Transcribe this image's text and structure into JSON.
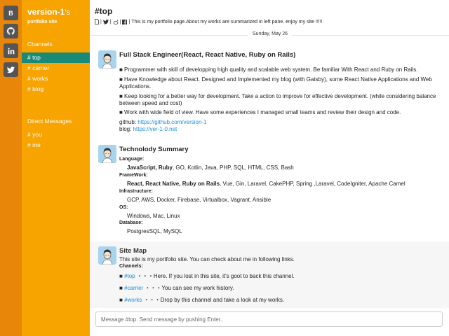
{
  "appbar": {
    "items": [
      {
        "label": "B",
        "icon": "blog-icon"
      },
      {
        "label": "",
        "icon": "github-icon"
      },
      {
        "label": "",
        "icon": "linkedin-icon"
      },
      {
        "label": "",
        "icon": "twitter-icon"
      }
    ]
  },
  "sidebar": {
    "workspace_name": "version-1",
    "workspace_suffix": "'s",
    "workspace_sub": "portfolio site",
    "channels_title": "Channels",
    "channels": [
      "# top",
      "# carrier",
      "# works",
      "# blog"
    ],
    "active_channel": "# top",
    "dm_title": "Direct Messages",
    "dms": [
      "# you",
      "# me"
    ]
  },
  "header": {
    "title": "#top",
    "topic_seps": [
      "|",
      "|",
      "|",
      "|"
    ],
    "topic": "This is my portfolio page.About my works are summarized in left pane. enjoy my site !!!!!"
  },
  "date_divider": "Sunday, May 26",
  "messages": {
    "m1": {
      "title": "Full Stack Engineer(React, React Native, Ruby on Rails)",
      "p1": "■ Programmer with skill of developping high quality and scalable web system. Be familiar With React and Ruby on Rails.",
      "p2": "■ Have Knowledge about React. Designed and Implemented my blog (with Gatsby), some React Native Applications and Web Applications.",
      "p3": "■ Keep looking for a better way for development. Take a action to improve for effective development. (while considering balance between speed and cost)",
      "p4": "■ Work with wide field of view. Have some experiences I managed small teams and review their design and code.",
      "github_label": "github: ",
      "github_url": "https://github.com/version-1",
      "blog_label": "blog: ",
      "blog_url": "https://ver-1-0.net"
    },
    "m2": {
      "title": "Technolody Summary",
      "lang_label": "Language:",
      "lang_bold": "JavaScript, Ruby",
      "lang_rest": ", GO, Kotlin, Java, PHP, SQL, HTML, CSS, Bash",
      "fw_label": "FrameWork:",
      "fw_bold": "React, React Native, Ruby on Rails",
      "fw_rest": ", Vue, Gin, Laravel, CakePHP, Spring ,Laravel, CodeIgniter, Apache Camel",
      "infra_label": "Infrastructure:",
      "infra": "GCP, AWS, Docker, Firebase, Virtualbox, Vagrant, Ansible",
      "os_label": "OS:",
      "os": "Windows, Mac, Linux",
      "db_label": "Database:",
      "db": "PostgresSQL, MySQL"
    },
    "m3": {
      "title": "Site Map",
      "intro": "This site is my portfolio site. You can check about me in following links.",
      "channels_label": "Channels:",
      "links": [
        {
          "bullet": "■ ",
          "link": "#top",
          "desc": " ・・・Here. If you lost in this site, it's goot to back this channel."
        },
        {
          "bullet": "■ ",
          "link": "#carrier",
          "desc": " ・・・You can see my work history."
        },
        {
          "bullet": "■ ",
          "link": "#works",
          "desc": " ・・・Drop by this channel and take a look at my works."
        }
      ]
    }
  },
  "composer": {
    "placeholder": "Message #top. Send message by pushing Enter..",
    "value": ""
  },
  "colors": {
    "appbar": "#e8860a",
    "sidebar": "#f7a300",
    "active_channel": "#1a8a77",
    "link": "#1a8fd6"
  }
}
